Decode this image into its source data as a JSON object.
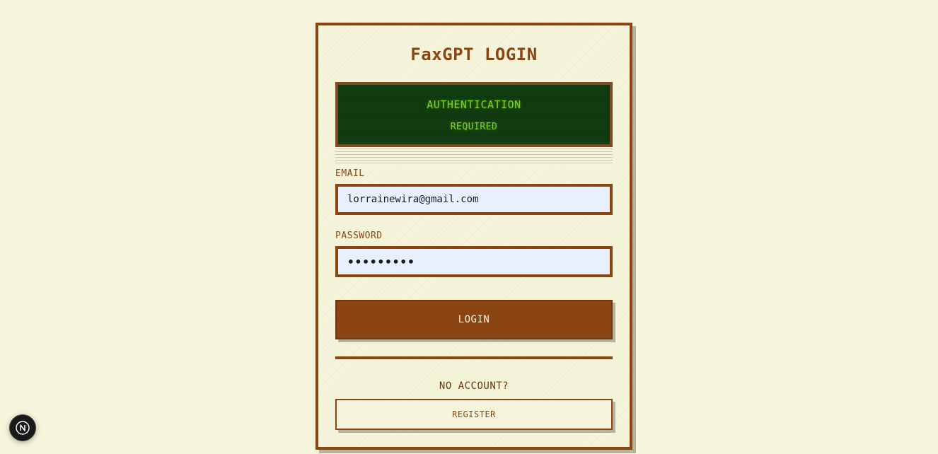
{
  "login": {
    "title": "FaxGPT LOGIN",
    "screen": {
      "line1": "AUTHENTICATION",
      "line2": "REQUIRED"
    },
    "email": {
      "label": "EMAIL",
      "value": "lorrainewira@gmail.com"
    },
    "password": {
      "label": "PASSWORD",
      "value": "•••••••••"
    },
    "login_button": "LOGIN",
    "no_account_text": "NO ACCOUNT?",
    "register_button": "REGISTER"
  },
  "dev_badge": {
    "icon": "nextjs-logo-icon"
  },
  "colors": {
    "background": "#f5f5dc",
    "accent": "#8b4513",
    "screen_bg": "#1a3a12",
    "screen_text": "#7cd32c",
    "input_bg": "#e8f0fe"
  }
}
